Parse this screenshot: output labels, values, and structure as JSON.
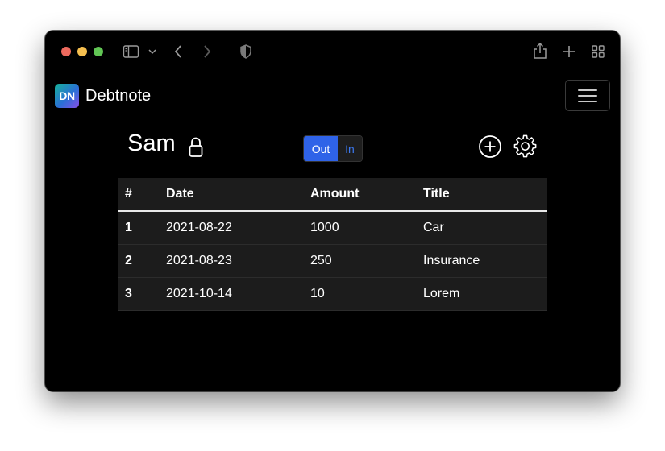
{
  "colors": {
    "accent": "#2f63e8",
    "accent_text": "#3b78f0",
    "logo_gradient": [
      "#16b39a",
      "#8a4fe8"
    ],
    "background": "#000000",
    "table_bg": "#1c1c1c"
  },
  "titlebar": {
    "icons": [
      "sidebar-icon",
      "chevron-down-icon",
      "back-icon",
      "forward-icon",
      "shield-icon",
      "share-icon",
      "new-tab-icon",
      "tab-overview-icon"
    ]
  },
  "navbar": {
    "logo_text": "DN",
    "brand_name": "Debtnote",
    "menu_icon": "hamburger-icon"
  },
  "header": {
    "user_name": "Sam",
    "lock_icon": "lock-icon",
    "toggle": {
      "options": [
        "Out",
        "In"
      ],
      "selected": "Out"
    },
    "add_icon": "plus-circle-icon",
    "settings_icon": "gear-icon"
  },
  "table": {
    "columns": [
      "#",
      "Date",
      "Amount",
      "Title"
    ],
    "rows": [
      [
        "1",
        "2021-08-22",
        "1000",
        "Car"
      ],
      [
        "2",
        "2021-08-23",
        "250",
        "Insurance"
      ],
      [
        "3",
        "2021-10-14",
        "10",
        "Lorem"
      ]
    ]
  }
}
